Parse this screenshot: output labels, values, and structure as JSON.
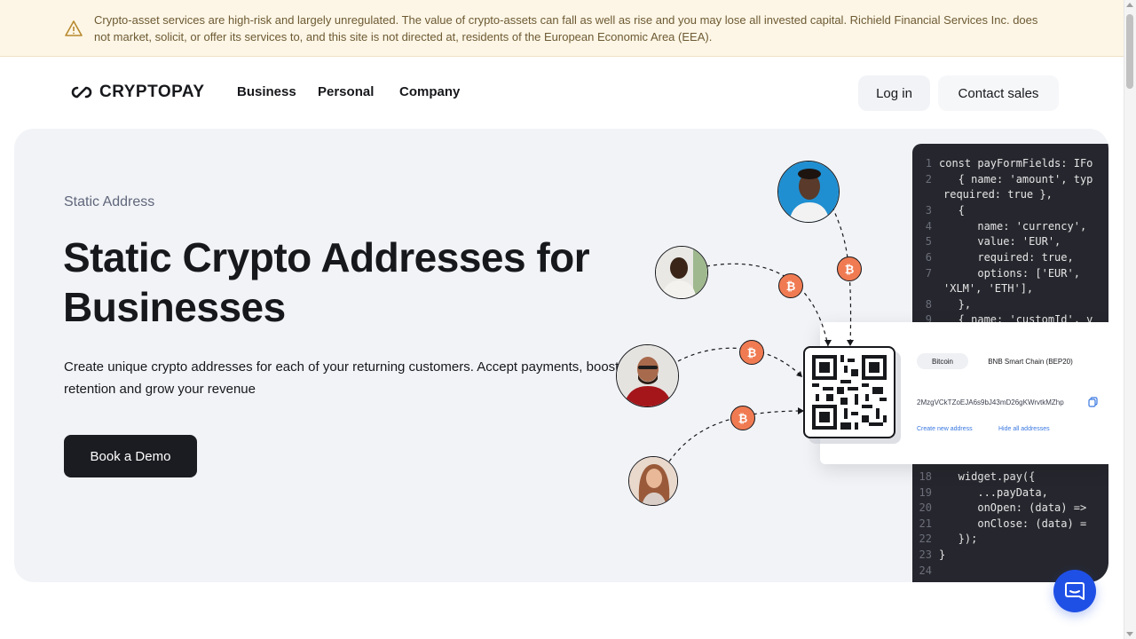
{
  "banner": {
    "text": "Crypto-asset services are high-risk and largely unregulated. The value of crypto-assets can fall as well as rise and you may lose all invested capital. Richield Financial Services Inc. does not market, solicit, or offer its services to, and this site is not directed at, residents of the European Economic Area (EEA).",
    "icon": "warning-icon"
  },
  "nav": {
    "logo": "CRYPTOPAY",
    "links": [
      "Business",
      "Personal",
      "Company"
    ],
    "login": "Log in",
    "contact": "Contact sales"
  },
  "hero": {
    "eyebrow": "Static Address",
    "headline": "Static Crypto Addresses for Businesses",
    "subtext": "Create unique crypto addresses for each of your returning customers. Accept payments, boost retention and grow your revenue",
    "cta": "Book a Demo"
  },
  "code": {
    "lines": [
      {
        "n": "1",
        "t": "const payFormFields: IFo"
      },
      {
        "n": "2",
        "t": "   { name: 'amount', typ"
      },
      {
        "n": "",
        "t": "required: true },"
      },
      {
        "n": "3",
        "t": "   {"
      },
      {
        "n": "4",
        "t": "      name: 'currency',"
      },
      {
        "n": "5",
        "t": "      value: 'EUR',"
      },
      {
        "n": "6",
        "t": "      required: true,"
      },
      {
        "n": "7",
        "t": "      options: ['EUR',"
      },
      {
        "n": "",
        "t": "'XLM', 'ETH'],"
      },
      {
        "n": "8",
        "t": "   },"
      },
      {
        "n": "9",
        "t": "   { name: 'customId', v"
      },
      {
        "n": "18",
        "t": "   widget.pay({"
      },
      {
        "n": "19",
        "t": "      ...payData,"
      },
      {
        "n": "20",
        "t": "      onOpen: (data) =>"
      },
      {
        "n": "21",
        "t": "      onClose: (data) ="
      },
      {
        "n": "22",
        "t": "   });"
      },
      {
        "n": "23",
        "t": "}"
      },
      {
        "n": "24",
        "t": ""
      }
    ]
  },
  "widget": {
    "tab_active": "Bitcoin",
    "tab_other": "BNB Smart Chain (BEP20)",
    "address": "2MzgVCkTZoEJA6s9bJ43mD26gKWrvtkMZhp",
    "create_link": "Create new address",
    "hide_link": "Hide all addresses"
  },
  "btc_symbol": "₿",
  "colors": {
    "accent_btc": "#f07b52",
    "chat": "#1f50e6",
    "hero_bg": "#f1f3f7"
  }
}
